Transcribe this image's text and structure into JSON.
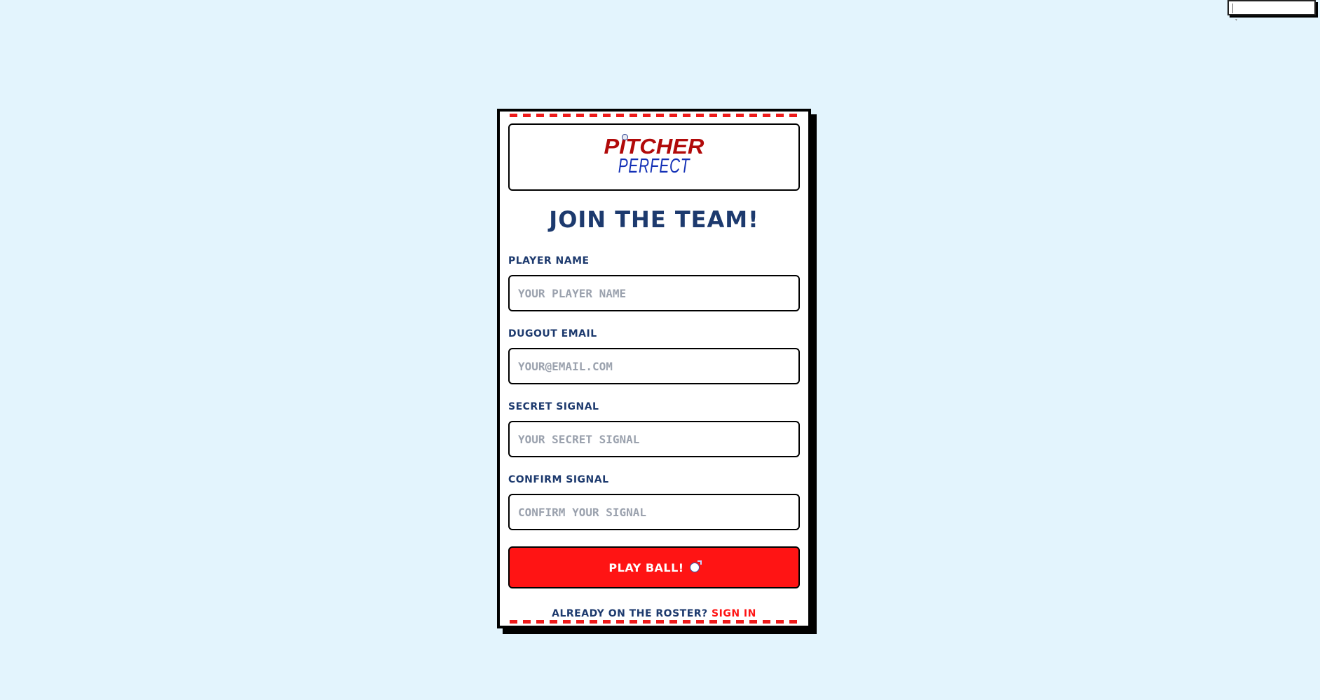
{
  "logo": {
    "line1": "PITCHER",
    "line2": "PERFECT"
  },
  "form": {
    "heading": "JOIN THE TEAM!",
    "fields": [
      {
        "label": "PLAYER NAME",
        "placeholder": "YOUR PLAYER NAME",
        "type": "text"
      },
      {
        "label": "DUGOUT EMAIL",
        "placeholder": "YOUR@EMAIL.COM",
        "type": "email"
      },
      {
        "label": "SECRET SIGNAL",
        "placeholder": "YOUR SECRET SIGNAL",
        "type": "password"
      },
      {
        "label": "CONFIRM SIGNAL",
        "placeholder": "CONFIRM YOUR SIGNAL",
        "type": "password"
      }
    ],
    "submit_label": "PLAY BALL!",
    "roster_prompt": "ALREADY ON THE ROSTER?",
    "sign_in_label": "SIGN IN"
  },
  "colors": {
    "background": "#e3f4fd",
    "accent_red": "#ff1414",
    "navy": "#1d3a6e",
    "logo_red": "#b10a0a",
    "logo_blue": "#1330b6"
  },
  "icons": {
    "submit_icon": "baseball-icon"
  }
}
